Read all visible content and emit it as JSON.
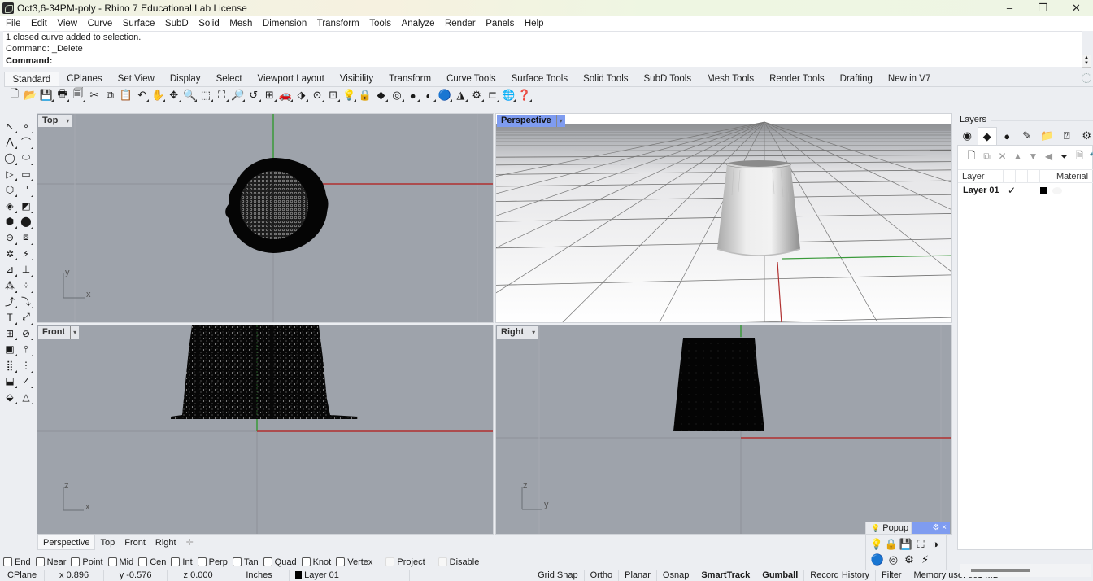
{
  "window": {
    "title": "Oct3,6-34PM-poly - Rhino 7 Educational Lab License",
    "minimize_glyph": "–",
    "restore_glyph": "❐",
    "close_glyph": "✕"
  },
  "menu": [
    "File",
    "Edit",
    "View",
    "Curve",
    "Surface",
    "SubD",
    "Solid",
    "Mesh",
    "Dimension",
    "Transform",
    "Tools",
    "Analyze",
    "Render",
    "Panels",
    "Help"
  ],
  "command": {
    "history": [
      "1 closed curve added to selection.",
      "Command: _Delete"
    ],
    "prompt": "Command:"
  },
  "toolbar_tabs": {
    "active": "Standard",
    "tabs": [
      "Standard",
      "CPlanes",
      "Set View",
      "Display",
      "Select",
      "Viewport Layout",
      "Visibility",
      "Transform",
      "Curve Tools",
      "Surface Tools",
      "Solid Tools",
      "SubD Tools",
      "Mesh Tools",
      "Render Tools",
      "Drafting",
      "New in V7"
    ]
  },
  "standard_toolbar": [
    {
      "icon": "new-file-icon",
      "glyph": "🗋"
    },
    {
      "icon": "open-folder-icon",
      "glyph": "📂"
    },
    {
      "icon": "save-icon",
      "glyph": "💾"
    },
    {
      "icon": "print-icon",
      "glyph": "🖶"
    },
    {
      "icon": "template-icon",
      "glyph": "🗐"
    },
    {
      "icon": "cut-icon",
      "glyph": "✂"
    },
    {
      "icon": "copy-icon",
      "glyph": "⧉"
    },
    {
      "icon": "paste-icon",
      "glyph": "📋"
    },
    {
      "icon": "undo-icon",
      "glyph": "↶"
    },
    {
      "icon": "pan-hand-icon",
      "glyph": "✋"
    },
    {
      "icon": "rotate-view-icon",
      "glyph": "✥"
    },
    {
      "icon": "zoom-icon",
      "glyph": "🔍"
    },
    {
      "icon": "zoom-window-icon",
      "glyph": "⬚"
    },
    {
      "icon": "zoom-extents-icon",
      "glyph": "⛶"
    },
    {
      "icon": "zoom-selected-icon",
      "glyph": "🔎"
    },
    {
      "icon": "undo-view-icon",
      "glyph": "↺"
    },
    {
      "icon": "four-viewports-icon",
      "glyph": "⊞"
    },
    {
      "icon": "named-position-car-icon",
      "glyph": "🚗"
    },
    {
      "icon": "select-filter-icon",
      "glyph": "⬗"
    },
    {
      "icon": "cplane-icon",
      "glyph": "⊙"
    },
    {
      "icon": "show-objects-icon",
      "glyph": "⊡"
    },
    {
      "icon": "light-bulb-icon",
      "glyph": "💡"
    },
    {
      "icon": "lock-icon",
      "glyph": "🔒"
    },
    {
      "icon": "layer-icon",
      "glyph": "◆"
    },
    {
      "icon": "color-wheel-icon",
      "glyph": "◎"
    },
    {
      "icon": "shaded-sphere-icon",
      "glyph": "●"
    },
    {
      "icon": "rendered-sphere-icon",
      "glyph": "◐"
    },
    {
      "icon": "render-icon",
      "glyph": "🔵"
    },
    {
      "icon": "materials-icon",
      "glyph": "◮"
    },
    {
      "icon": "options-gear-icon",
      "glyph": "⚙"
    },
    {
      "icon": "grid-snap-icon",
      "glyph": "⊏"
    },
    {
      "icon": "globe-icon",
      "glyph": "🌐"
    },
    {
      "icon": "help-icon",
      "glyph": "❓"
    }
  ],
  "left_toolbar": [
    [
      {
        "icon": "select-arrow-icon",
        "glyph": "↖"
      },
      {
        "icon": "point-icon",
        "glyph": "∘"
      }
    ],
    [
      {
        "icon": "polyline-icon",
        "glyph": "⋀"
      },
      {
        "icon": "curve-icon",
        "glyph": "⌒"
      }
    ],
    [
      {
        "icon": "circle-icon",
        "glyph": "◯"
      },
      {
        "icon": "ellipse-icon",
        "glyph": "⬭"
      }
    ],
    [
      {
        "icon": "arc-icon",
        "glyph": "▷"
      },
      {
        "icon": "rectangle-icon",
        "glyph": "▭"
      }
    ],
    [
      {
        "icon": "polygon-icon",
        "glyph": "⬡"
      },
      {
        "icon": "fillet-curve-icon",
        "glyph": "⌝"
      }
    ],
    [
      {
        "icon": "surface-from-points-icon",
        "glyph": "◈"
      },
      {
        "icon": "surface-loft-icon",
        "glyph": "◩"
      }
    ],
    [
      {
        "icon": "box-icon",
        "glyph": "⬢"
      },
      {
        "icon": "sphere-icon",
        "glyph": "⬤"
      }
    ],
    [
      {
        "icon": "cylinder-icon",
        "glyph": "⊖"
      },
      {
        "icon": "mesh-icon",
        "glyph": "⧈"
      }
    ],
    [
      {
        "icon": "explode-gear-icon",
        "glyph": "✲"
      },
      {
        "icon": "boolean-icon",
        "glyph": "⚡"
      }
    ],
    [
      {
        "icon": "extend-icon",
        "glyph": "⊿"
      },
      {
        "icon": "trim-icon",
        "glyph": "⊥"
      }
    ],
    [
      {
        "icon": "group-icon",
        "glyph": "⁂"
      },
      {
        "icon": "ungroup-icon",
        "glyph": "⁘"
      }
    ],
    [
      {
        "icon": "offset-icon",
        "glyph": "⤴"
      },
      {
        "icon": "blend-curve-icon",
        "glyph": "⤵"
      }
    ],
    [
      {
        "icon": "text-icon",
        "glyph": "T"
      },
      {
        "icon": "transform-move-icon",
        "glyph": "⤢"
      }
    ],
    [
      {
        "icon": "array-icon",
        "glyph": "⊞"
      },
      {
        "icon": "scale-icon",
        "glyph": "⊘"
      }
    ],
    [
      {
        "icon": "analyze-icon",
        "glyph": "▣"
      },
      {
        "icon": "dimension-icon",
        "glyph": "⫯"
      }
    ],
    [
      {
        "icon": "grid-array-icon",
        "glyph": "⣿"
      },
      {
        "icon": "linked-block-icon",
        "glyph": "⋮"
      }
    ],
    [
      {
        "icon": "rotate-3d-icon",
        "glyph": "⬓"
      },
      {
        "icon": "check-icon",
        "glyph": "✓"
      }
    ],
    [
      {
        "icon": "shell-icon",
        "glyph": "⬙"
      },
      {
        "icon": "render-pyramid-icon",
        "glyph": "△"
      }
    ]
  ],
  "viewports": {
    "top": {
      "label": "Top",
      "axis_a": "y",
      "axis_b": "x"
    },
    "perspective": {
      "label": "Perspective"
    },
    "front": {
      "label": "Front",
      "axis_a": "z",
      "axis_b": "x"
    },
    "right": {
      "label": "Right",
      "axis_a": "z",
      "axis_b": "y"
    },
    "active": "Perspective",
    "caret": "▾"
  },
  "viewport_tabs": {
    "active": "Perspective",
    "tabs": [
      "Perspective",
      "Top",
      "Front",
      "Right"
    ],
    "add_glyph": "✛"
  },
  "osnaps": [
    {
      "label": "End",
      "checked": false,
      "enabled": true
    },
    {
      "label": "Near",
      "checked": false,
      "enabled": true
    },
    {
      "label": "Point",
      "checked": false,
      "enabled": true
    },
    {
      "label": "Mid",
      "checked": false,
      "enabled": true
    },
    {
      "label": "Cen",
      "checked": false,
      "enabled": true
    },
    {
      "label": "Int",
      "checked": false,
      "enabled": true
    },
    {
      "label": "Perp",
      "checked": false,
      "enabled": true
    },
    {
      "label": "Tan",
      "checked": false,
      "enabled": true
    },
    {
      "label": "Quad",
      "checked": false,
      "enabled": true
    },
    {
      "label": "Knot",
      "checked": false,
      "enabled": true
    },
    {
      "label": "Vertex",
      "checked": false,
      "enabled": true
    },
    {
      "label": "Project",
      "checked": false,
      "enabled": false
    },
    {
      "label": "Disable",
      "checked": false,
      "enabled": false
    }
  ],
  "status": {
    "cplane": "CPlane",
    "x": "x 0.896",
    "y": "y -0.576",
    "z": "z 0.000",
    "units": "Inches",
    "layer": "Layer 01",
    "toggles": [
      {
        "label": "Grid Snap",
        "on": false
      },
      {
        "label": "Ortho",
        "on": false
      },
      {
        "label": "Planar",
        "on": false
      },
      {
        "label": "Osnap",
        "on": false
      },
      {
        "label": "SmartTrack",
        "on": true
      },
      {
        "label": "Gumball",
        "on": true
      },
      {
        "label": "Record History",
        "on": false
      },
      {
        "label": "Filter",
        "on": false
      }
    ],
    "memory": "Memory use: 601 MB"
  },
  "layers_panel": {
    "title": "Layers",
    "tabs": [
      {
        "icon": "color-wheel-icon",
        "glyph": "◉"
      },
      {
        "icon": "layers-icon",
        "glyph": "◆",
        "active": true
      },
      {
        "icon": "render-sphere-icon",
        "glyph": "●"
      },
      {
        "icon": "pen-icon",
        "glyph": "✎"
      },
      {
        "icon": "folder-icon",
        "glyph": "📁"
      },
      {
        "icon": "help-window-icon",
        "glyph": "⍰"
      },
      {
        "icon": "panel-gear-icon",
        "glyph": "⚙"
      }
    ],
    "tools": [
      {
        "icon": "new-layer-icon",
        "glyph": "🗋",
        "enabled": true
      },
      {
        "icon": "new-sublayer-icon",
        "glyph": "⧉",
        "enabled": false
      },
      {
        "icon": "delete-layer-icon",
        "glyph": "✕",
        "enabled": false
      },
      {
        "icon": "move-up-icon",
        "glyph": "▲",
        "enabled": false
      },
      {
        "icon": "move-down-icon",
        "glyph": "▼",
        "enabled": false
      },
      {
        "icon": "move-out-icon",
        "glyph": "◀",
        "enabled": false
      },
      {
        "icon": "filter-icon",
        "glyph": "⏷",
        "enabled": true
      },
      {
        "icon": "layer-state-icon",
        "glyph": "🗎",
        "enabled": false
      },
      {
        "icon": "tools-hammer-icon",
        "glyph": "🔨",
        "enabled": true
      }
    ],
    "columns": [
      "Layer",
      "",
      "",
      "",
      "",
      "Material"
    ],
    "rows": [
      {
        "name": "Layer 01",
        "current": "✓",
        "color": "#000000"
      }
    ]
  },
  "popup": {
    "title": "Popup",
    "gear": "⚙",
    "close": "×",
    "rows": [
      [
        {
          "icon": "light-bulb-icon",
          "glyph": "💡"
        },
        {
          "icon": "lock-icon",
          "glyph": "🔒"
        },
        {
          "icon": "save-icon",
          "glyph": "💾"
        },
        {
          "icon": "zoom-extents-icon",
          "glyph": "⛶"
        },
        {
          "icon": "shaded-sphere-icon",
          "glyph": "◑"
        }
      ],
      [
        {
          "icon": "render-sphere-icon",
          "glyph": "🔵"
        },
        {
          "icon": "color-wheel-icon",
          "glyph": "◎"
        },
        {
          "icon": "options-gear-icon",
          "glyph": "⚙"
        },
        {
          "icon": "boolean-icon",
          "glyph": "⚡"
        }
      ]
    ]
  },
  "colors": {
    "viewport_bg": "#9ea3ab",
    "active_viewport_label": "#7f9cf0",
    "x_axis": "#b03030",
    "y_axis": "#3a9a3a",
    "grid_line": "#8d9299"
  }
}
